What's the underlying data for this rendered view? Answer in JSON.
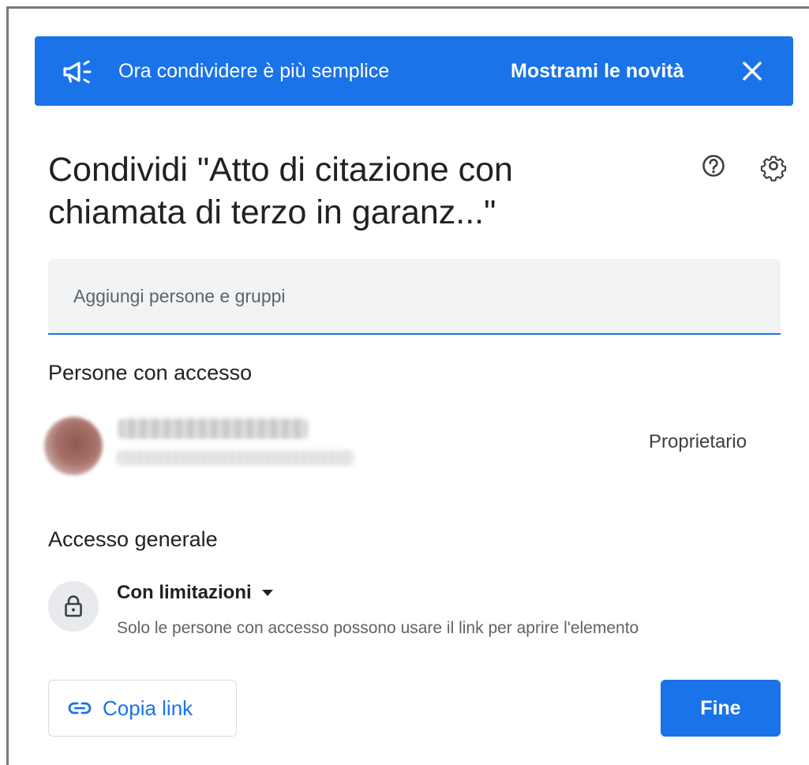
{
  "banner": {
    "icon": "megaphone-icon",
    "text": "Ora condividere è più semplice",
    "link_label": "Mostrami le novità",
    "close_icon": "close-icon",
    "background": "#1a73e8"
  },
  "dialog": {
    "title": "Condividi \"Atto di citazione con chiamata di terzo in garanz...\"",
    "help_icon": "help-icon",
    "settings_icon": "gear-icon"
  },
  "add_people": {
    "placeholder": "Aggiungi persone e gruppi",
    "value": ""
  },
  "people_with_access": {
    "heading": "Persone con accesso",
    "people": [
      {
        "avatar": "avatar",
        "role": "Proprietario"
      }
    ]
  },
  "general_access": {
    "heading": "Accesso generale",
    "icon": "lock-icon",
    "selected": "Con limitazioni",
    "description": "Solo le persone con accesso possono usare il link per aprire l'elemento"
  },
  "footer": {
    "copy_link_icon": "link-icon",
    "copy_link_label": "Copia link",
    "done_label": "Fine"
  },
  "colors": {
    "accent": "#1a73e8",
    "text_primary": "#202124",
    "text_secondary": "#5f6368",
    "input_background": "#f1f3f4"
  }
}
